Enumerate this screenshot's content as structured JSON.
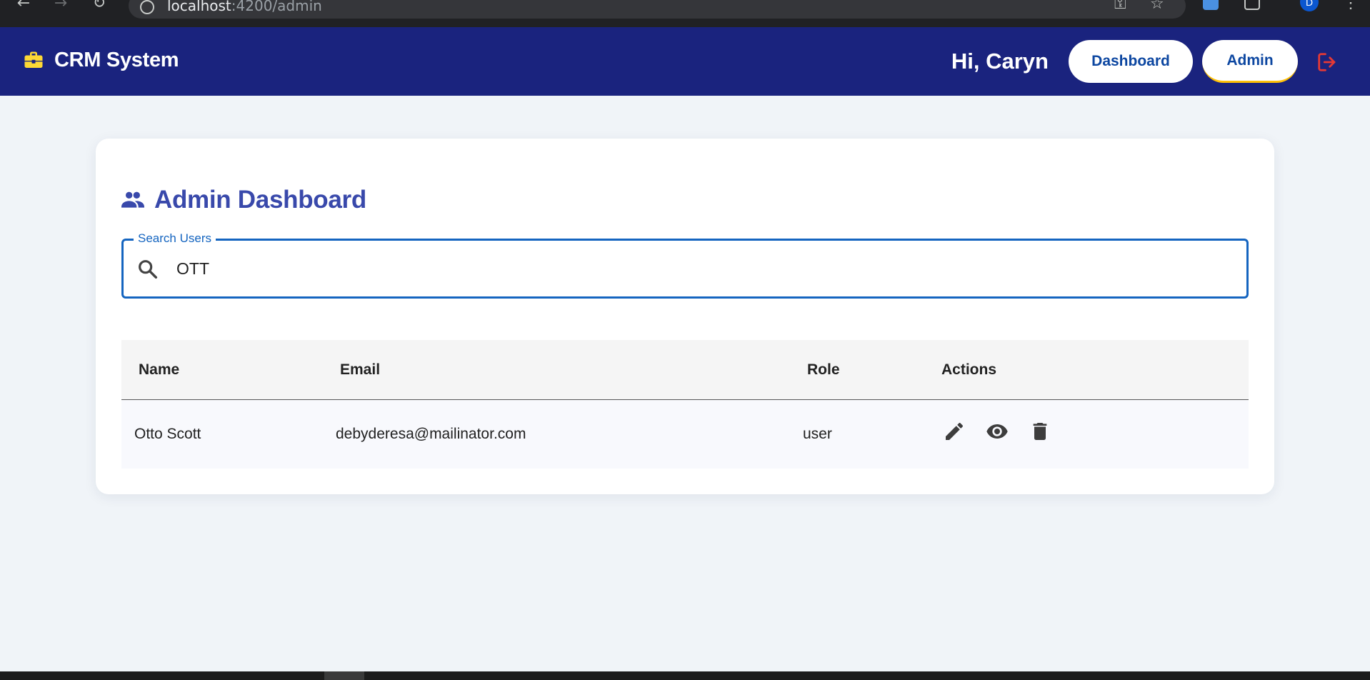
{
  "browser": {
    "url_host": "localhost",
    "url_path": ":4200/admin",
    "profile_initial": "D"
  },
  "header": {
    "brand_title": "CRM System",
    "greeting": "Hi, Caryn",
    "nav": {
      "dashboard_label": "Dashboard",
      "admin_label": "Admin"
    },
    "colors": {
      "bar": "#1a237e",
      "brand_icon": "#fdd835",
      "logout_icon": "#e53935",
      "active_underline": "#ffc107"
    },
    "icons": {
      "brand": "briefcase-icon",
      "logout": "logout-icon"
    }
  },
  "main": {
    "title": "Admin Dashboard",
    "title_icon": "people-icon",
    "search": {
      "label": "Search Users",
      "value": "OTT",
      "icon": "search-icon"
    },
    "table": {
      "headers": {
        "name": "Name",
        "email": "Email",
        "role": "Role",
        "actions": "Actions"
      },
      "rows": [
        {
          "name": "Otto Scott",
          "email": "debyderesa@mailinator.com",
          "role": "user",
          "actions": [
            "edit-icon",
            "view-icon",
            "delete-icon"
          ]
        }
      ]
    }
  }
}
